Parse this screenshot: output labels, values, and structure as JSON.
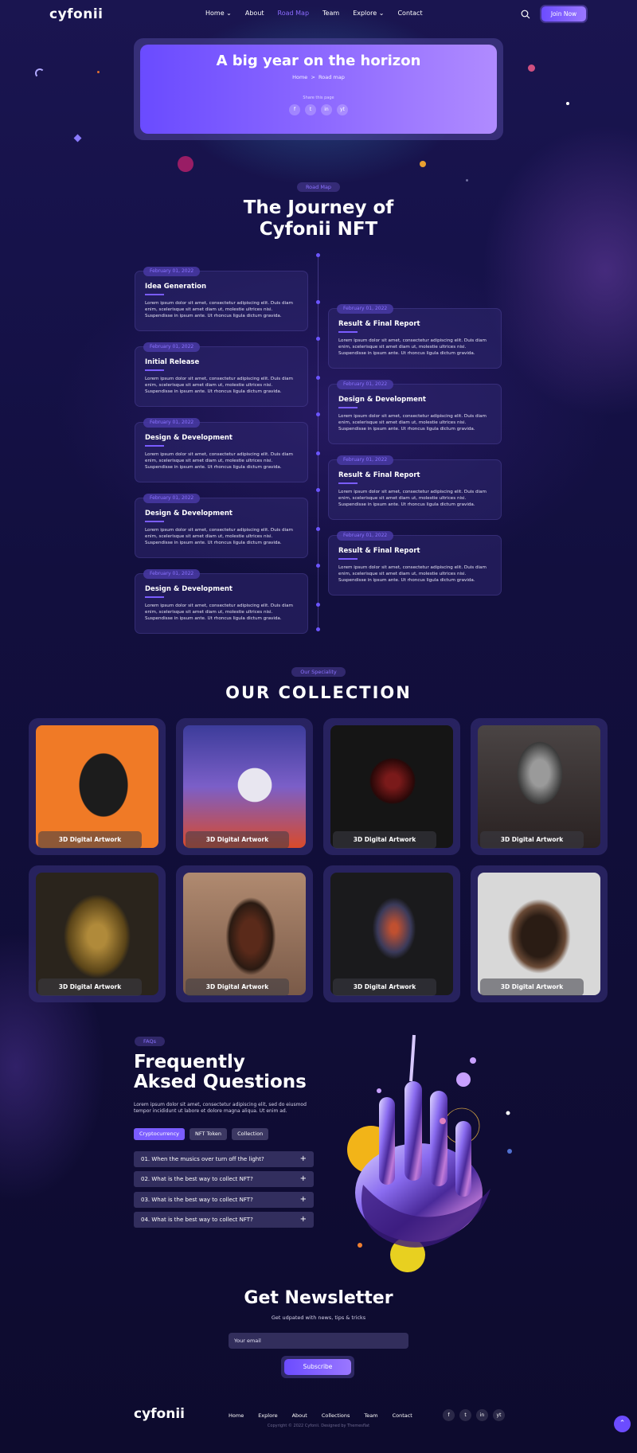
{
  "header": {
    "logo": "cyfonii",
    "nav": [
      {
        "label": "Home",
        "chevron": true
      },
      {
        "label": "About",
        "chevron": false
      },
      {
        "label": "Road Map",
        "chevron": false,
        "active": true
      },
      {
        "label": "Team",
        "chevron": false
      },
      {
        "label": "Explore",
        "chevron": true
      },
      {
        "label": "Contact",
        "chevron": false
      }
    ],
    "join_label": "Join Now"
  },
  "hero": {
    "title": "A big year on the horizon",
    "breadcrumb_home": "Home",
    "breadcrumb_sep": ">",
    "breadcrumb_current": "Road map",
    "share_label": "Share this page",
    "socials": [
      "f",
      "t",
      "in",
      "yt"
    ]
  },
  "roadmap": {
    "pill": "Road Map",
    "title_line1": "The Journey of",
    "title_line2": "Cyfonii NFT",
    "items": [
      {
        "date": "February 01, 2022",
        "title": "Idea Generation",
        "desc": "Lorem ipsum dolor sit amet, consectetur adipiscing elit. Duis diam enim, scelerisque sit amet diam ut, molestie ultrices nisi. Suspendisse in ipsum ante. Ut rhoncus ligula dictum gravida."
      },
      {
        "date": "February 01, 2022",
        "title": "Result & Final Report",
        "desc": "Lorem ipsum dolor sit amet, consectetur adipiscing elit. Duis diam enim, scelerisque sit amet diam ut, molestie ultrices nisi. Suspendisse in ipsum ante. Ut rhoncus ligula dictum gravida."
      },
      {
        "date": "February 01, 2022",
        "title": "Initial Release",
        "desc": "Lorem ipsum dolor sit amet, consectetur adipiscing elit. Duis diam enim, scelerisque sit amet diam ut, molestie ultrices nisi. Suspendisse in ipsum ante. Ut rhoncus ligula dictum gravida."
      },
      {
        "date": "February 01, 2022",
        "title": "Design & Development",
        "desc": "Lorem ipsum dolor sit amet, consectetur adipiscing elit. Duis diam enim, scelerisque sit amet diam ut, molestie ultrices nisi. Suspendisse in ipsum ante. Ut rhoncus ligula dictum gravida."
      },
      {
        "date": "February 01, 2022",
        "title": "Design & Development",
        "desc": "Lorem ipsum dolor sit amet, consectetur adipiscing elit. Duis diam enim, scelerisque sit amet diam ut, molestie ultrices nisi. Suspendisse in ipsum ante. Ut rhoncus ligula dictum gravida."
      },
      {
        "date": "February 01, 2022",
        "title": "Result & Final Report",
        "desc": "Lorem ipsum dolor sit amet, consectetur adipiscing elit. Duis diam enim, scelerisque sit amet diam ut, molestie ultrices nisi. Suspendisse in ipsum ante. Ut rhoncus ligula dictum gravida."
      },
      {
        "date": "February 01, 2022",
        "title": "Design & Development",
        "desc": "Lorem ipsum dolor sit amet, consectetur adipiscing elit. Duis diam enim, scelerisque sit amet diam ut, molestie ultrices nisi. Suspendisse in ipsum ante. Ut rhoncus ligula dictum gravida."
      },
      {
        "date": "February 01, 2022",
        "title": "Result & Final Report",
        "desc": "Lorem ipsum dolor sit amet, consectetur adipiscing elit. Duis diam enim, scelerisque sit amet diam ut, molestie ultrices nisi. Suspendisse in ipsum ante. Ut rhoncus ligula dictum gravida."
      },
      {
        "date": "February 01, 2022",
        "title": "Design & Development",
        "desc": "Lorem ipsum dolor sit amet, consectetur adipiscing elit. Duis diam enim, scelerisque sit amet diam ut, molestie ultrices nisi. Suspendisse in ipsum ante. Ut rhoncus ligula dictum gravida."
      }
    ]
  },
  "collection": {
    "pill": "Our Speciality",
    "title": "OUR COLLECTION",
    "items": [
      {
        "label": "3D Digital Artwork",
        "bg": "#f07a26"
      },
      {
        "label": "3D Digital Artwork",
        "bg": "#7b5fc8"
      },
      {
        "label": "3D Digital Artwork",
        "bg": "#151515"
      },
      {
        "label": "3D Digital Artwork",
        "bg": "#3a3a3a"
      },
      {
        "label": "3D Digital Artwork",
        "bg": "#2a241c"
      },
      {
        "label": "3D Digital Artwork",
        "bg": "#8a6a55"
      },
      {
        "label": "3D Digital Artwork",
        "bg": "#1a1a1c"
      },
      {
        "label": "3D Digital Artwork",
        "bg": "#d8d8d8"
      }
    ]
  },
  "faq": {
    "pill": "FAQs",
    "title_line1": "Frequently",
    "title_line2": "Aksed Questions",
    "desc": "Lorem ipsum dolor sit amet, consectetur adipiscing elit, sed do eiusmod tempor incididunt ut labore et dolore magna aliqua. Ut enim ad.",
    "tabs": [
      "Cryptocurrency",
      "NFT Token",
      "Collection"
    ],
    "questions": [
      "01. When the musics over turn off the light?",
      "02. What is the best way to collect NFT?",
      "03. What is the best way to collect NFT?",
      "04. What is the best way to collect NFT?"
    ]
  },
  "newsletter": {
    "title": "Get Newsletter",
    "subtitle": "Get udpated with news, tips & tricks",
    "placeholder": "Your email",
    "button": "Subscribe"
  },
  "footer": {
    "logo": "cyfonii",
    "nav": [
      "Home",
      "Explore",
      "About",
      "Collections",
      "Team",
      "Contact"
    ],
    "socials": [
      "f",
      "t",
      "in",
      "yt"
    ],
    "copyright": "Copyright © 2022 Cyfonii. Designed by Themesflat"
  },
  "colors": {
    "accent": "#7a5cff",
    "pill_text": "#8b72ff",
    "background": "#120f3e"
  }
}
